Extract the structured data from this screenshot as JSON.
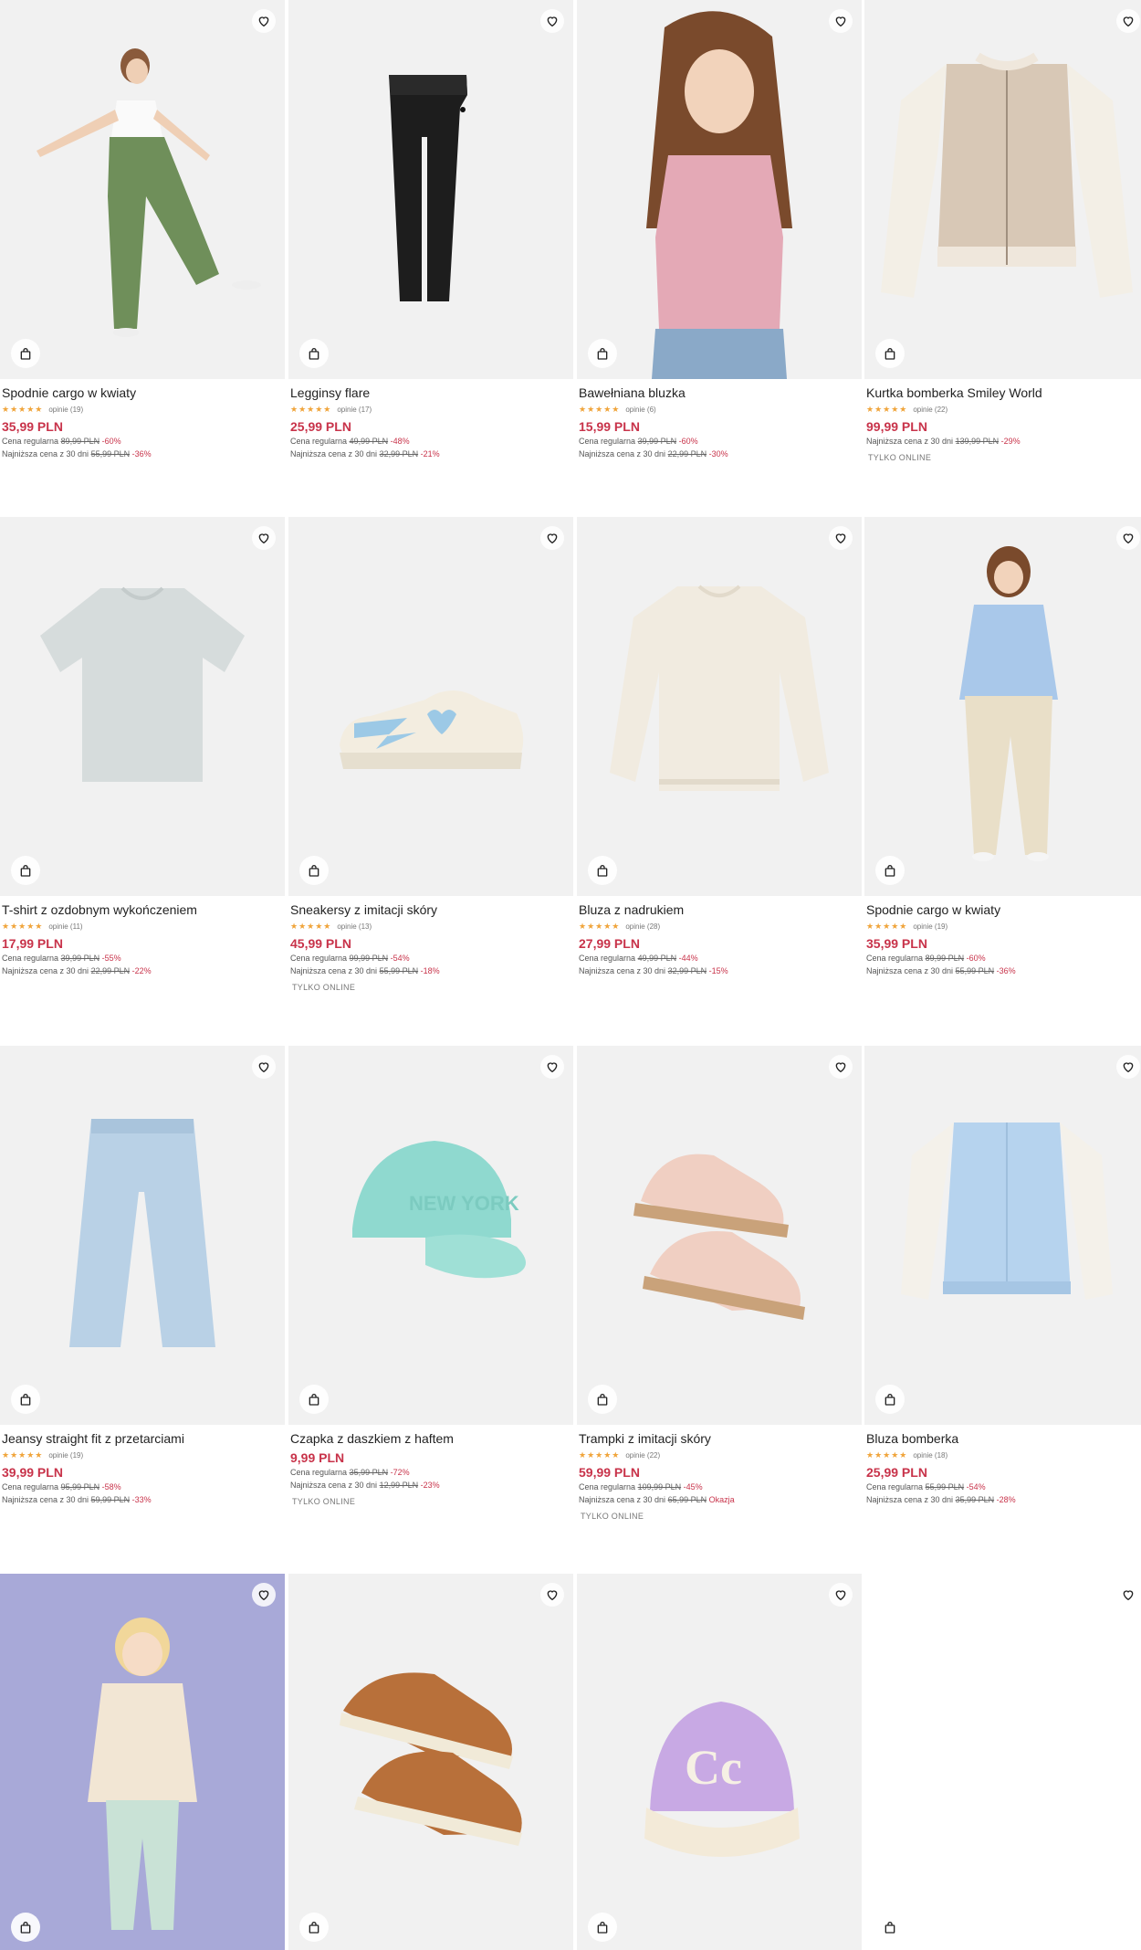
{
  "colors": {
    "accent": "#c8334a",
    "star": "#f0a43a",
    "tile_bg": "#f1f1f1"
  },
  "labels": {
    "regular": "Cena regularna",
    "lowest": "Najniższa cena z 30 dni"
  },
  "icons": {
    "favorite": "heart-outline-icon",
    "cart": "shopping-bag-icon",
    "rating": "star-icon"
  },
  "products": [
    {
      "name": "Spodnie cargo w kwiaty",
      "stars": "★★★★★",
      "reviews": "opinie (19)",
      "price": "35,99 PLN",
      "regular_price": "89,99 PLN",
      "regular_disc": "-60%",
      "lowest_price": "55,99 PLN",
      "lowest_disc": "-36%",
      "tag": ""
    },
    {
      "name": "Legginsy flare",
      "stars": "★★★★★",
      "reviews": "opinie (17)",
      "price": "25,99 PLN",
      "regular_price": "49,99 PLN",
      "regular_disc": "-48%",
      "lowest_price": "32,99 PLN",
      "lowest_disc": "-21%",
      "tag": ""
    },
    {
      "name": "Bawełniana bluzka",
      "stars": "★★★★★",
      "reviews": "opinie (6)",
      "price": "15,99 PLN",
      "regular_price": "39,99 PLN",
      "regular_disc": "-60%",
      "lowest_price": "22,99 PLN",
      "lowest_disc": "-30%",
      "tag": ""
    },
    {
      "name": "Kurtka bomberka Smiley World",
      "stars": "★★★★★",
      "reviews": "opinie (22)",
      "price": "99,99 PLN",
      "regular_price": "",
      "regular_disc": "",
      "lowest_price": "139,99 PLN",
      "lowest_disc": "-29%",
      "tag": "TYLKO ONLINE"
    },
    {
      "name": "T-shirt z ozdobnym wykończeniem",
      "stars": "★★★★★",
      "reviews": "opinie (11)",
      "price": "17,99 PLN",
      "regular_price": "39,99 PLN",
      "regular_disc": "-55%",
      "lowest_price": "22,99 PLN",
      "lowest_disc": "-22%",
      "tag": ""
    },
    {
      "name": "Sneakersy z imitacji skóry",
      "stars": "★★★★★",
      "reviews": "opinie (13)",
      "price": "45,99 PLN",
      "regular_price": "99,99 PLN",
      "regular_disc": "-54%",
      "lowest_price": "55,99 PLN",
      "lowest_disc": "-18%",
      "tag": "TYLKO ONLINE"
    },
    {
      "name": "Bluza z nadrukiem",
      "stars": "★★★★★",
      "reviews": "opinie (28)",
      "price": "27,99 PLN",
      "regular_price": "49,99 PLN",
      "regular_disc": "-44%",
      "lowest_price": "32,99 PLN",
      "lowest_disc": "-15%",
      "tag": ""
    },
    {
      "name": "Spodnie cargo w kwiaty",
      "stars": "★★★★★",
      "reviews": "opinie (19)",
      "price": "35,99 PLN",
      "regular_price": "89,99 PLN",
      "regular_disc": "-60%",
      "lowest_price": "55,99 PLN",
      "lowest_disc": "-36%",
      "tag": ""
    },
    {
      "name": "Jeansy straight fit z przetarciami",
      "stars": "★★★★★",
      "reviews": "opinie (19)",
      "price": "39,99 PLN",
      "regular_price": "95,99 PLN",
      "regular_disc": "-58%",
      "lowest_price": "59,99 PLN",
      "lowest_disc": "-33%",
      "tag": ""
    },
    {
      "name": "Czapka z daszkiem z haftem",
      "stars": "",
      "reviews": "",
      "price": "9,99 PLN",
      "regular_price": "35,99 PLN",
      "regular_disc": "-72%",
      "lowest_price": "12,99 PLN",
      "lowest_disc": "-23%",
      "tag": "TYLKO ONLINE"
    },
    {
      "name": "Trampki z imitacji skóry",
      "stars": "★★★★★",
      "reviews": "opinie (22)",
      "price": "59,99 PLN",
      "regular_price": "109,99 PLN",
      "regular_disc": "-45%",
      "lowest_price": "65,99 PLN",
      "lowest_disc": "Okazja",
      "tag": "TYLKO ONLINE"
    },
    {
      "name": "Bluza bomberka",
      "stars": "★★★★★",
      "reviews": "opinie (18)",
      "price": "25,99 PLN",
      "regular_price": "55,99 PLN",
      "regular_disc": "-54%",
      "lowest_price": "35,99 PLN",
      "lowest_disc": "-28%",
      "tag": ""
    },
    {
      "name": "",
      "stars": "",
      "reviews": "",
      "price": "",
      "regular_price": "",
      "regular_disc": "",
      "lowest_price": "",
      "lowest_disc": "",
      "tag": ""
    },
    {
      "name": "",
      "stars": "",
      "reviews": "",
      "price": "",
      "regular_price": "",
      "regular_disc": "",
      "lowest_price": "",
      "lowest_disc": "",
      "tag": ""
    },
    {
      "name": "",
      "stars": "",
      "reviews": "",
      "price": "",
      "regular_price": "",
      "regular_disc": "",
      "lowest_price": "",
      "lowest_disc": "",
      "tag": ""
    },
    {
      "name": "",
      "stars": "",
      "reviews": "",
      "price": "",
      "regular_price": "",
      "regular_disc": "",
      "lowest_price": "",
      "lowest_disc": "",
      "tag": ""
    }
  ]
}
